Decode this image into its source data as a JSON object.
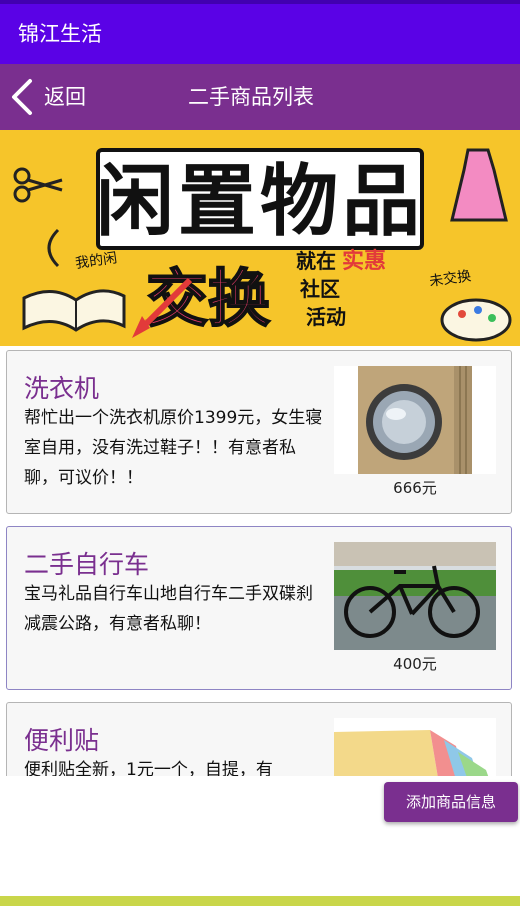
{
  "app": {
    "title": "锦江生活"
  },
  "nav": {
    "back_label": "返回",
    "title": "二手商品列表"
  },
  "banner": {
    "headline": "闲置物品",
    "exchange": "交换",
    "slogan_prefix": "就在",
    "slogan_highlight": "实惠",
    "slogan_line2": "社区",
    "slogan_line3": "活动",
    "tag_left": "我的闲",
    "tag_right": "未交换"
  },
  "items": [
    {
      "title": "洗衣机",
      "description": "帮忙出一个洗衣机原价1399元，女生寝室自用，没有洗过鞋子！！有意者私聊，可议价！！",
      "price": "666元"
    },
    {
      "title": "二手自行车",
      "description": "宝马礼品自行车山地自行车二手双碟刹减震公路，有意者私聊！",
      "price": "400元"
    },
    {
      "title": "便利贴",
      "description": "便利贴全新，1元一个，自提，有"
    }
  ],
  "actions": {
    "add_label": "添加商品信息"
  },
  "colors": {
    "appbar": "#5a02e6",
    "navbar": "#7a2f8f",
    "accent_text": "#7a2f8f",
    "banner_bg": "#f6c52a"
  }
}
